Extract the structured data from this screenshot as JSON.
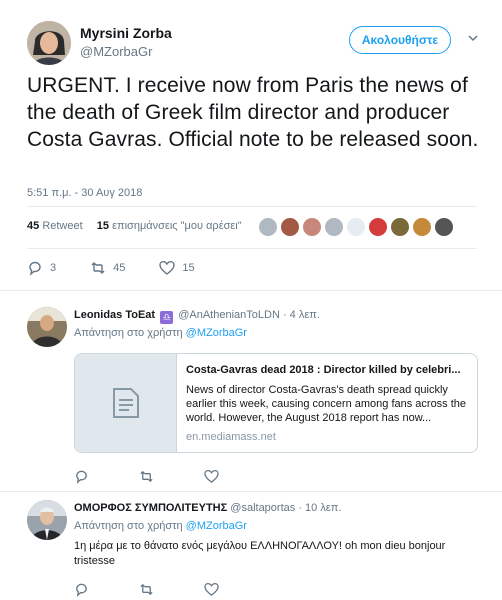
{
  "tweet": {
    "author_name": "Myrsini Zorba",
    "author_handle": "@MZorbaGr",
    "follow_label": "Ακολουθήστε",
    "text": "URGENT. I receive now from Paris the news of the death of Greek film director and producer Costa Gavras. Official note to be released soon.",
    "timestamp": "5:51 π.μ. - 30 Αυγ 2018",
    "retweets_count": "45",
    "retweets_label": "Retweet",
    "likes_count": "15",
    "likes_label": "επισημάνσεις \"μου αρέσει\"",
    "replies": "3",
    "retweets": "45",
    "likes": "15",
    "liker_colors": [
      "#b0b8c1",
      "#a35a44",
      "#c7877a",
      "#b0b8c1",
      "#e6ecf0",
      "#d43c3c",
      "#7a6a3a",
      "#c48a3a",
      "#555555"
    ]
  },
  "replies": [
    {
      "name": "Leonidas ToEat",
      "handle": "@AnAthenianToLDN",
      "time": "· 4 λεπ.",
      "reply_to_label": "Απάντηση στο χρήστη",
      "reply_to_handle": "@MZorbaGr",
      "card": {
        "title": "Costa-Gavras dead 2018 : Director killed by celebri...",
        "description": "News of director Costa-Gavras's death spread quickly earlier this week, causing concern among fans across the world. However, the August 2018 report has now...",
        "url": "en.mediamass.net"
      }
    },
    {
      "name": "ΟΜΟΡΦΟΣ ΣΥΜΠΟΛΙΤΕΥΤΗΣ",
      "handle": "@saltaportas",
      "time": "· 10 λεπ.",
      "reply_to_label": "Απάντηση στο χρήστη",
      "reply_to_handle": "@MZorbaGr",
      "text": "1η μέρα με το θάνατο ενός μεγάλου ΕΛΛΗΝΟΓΑΛΛΟΥ! oh mon dieu bonjour tristesse"
    }
  ],
  "colors": {
    "accent": "#1da1f2",
    "muted": "#657786",
    "border": "#e6ecf0"
  }
}
